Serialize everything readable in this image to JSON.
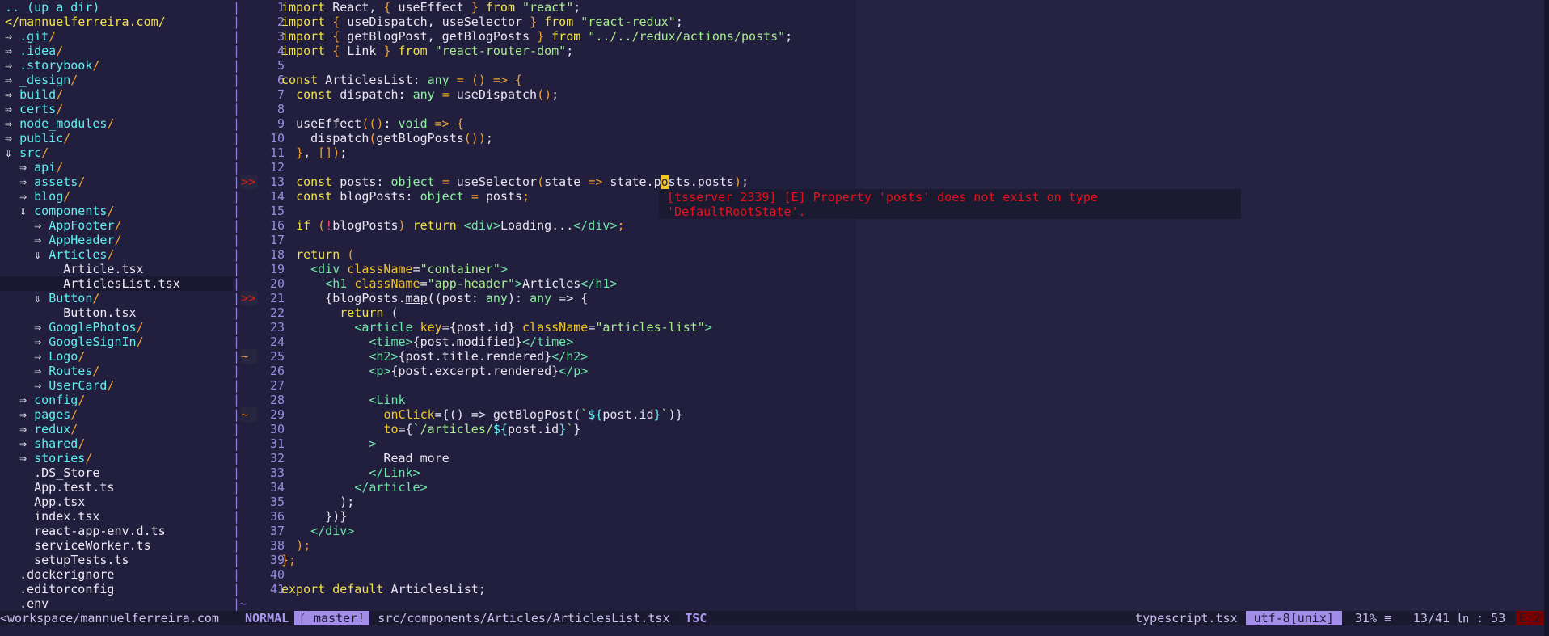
{
  "tree": [
    {
      "kind": "up",
      "text": ".. (up a dir)"
    },
    {
      "kind": "root",
      "text": "</mannuelferreira.com/"
    },
    {
      "kind": "dir",
      "indent": 0,
      "arrow": "⇒",
      "name": ".git"
    },
    {
      "kind": "dir",
      "indent": 0,
      "arrow": "⇒",
      "name": ".idea"
    },
    {
      "kind": "dir",
      "indent": 0,
      "arrow": "⇒",
      "name": ".storybook"
    },
    {
      "kind": "dir",
      "indent": 0,
      "arrow": "⇒",
      "name": "_design"
    },
    {
      "kind": "dir",
      "indent": 0,
      "arrow": "⇒",
      "name": "build"
    },
    {
      "kind": "dir",
      "indent": 0,
      "arrow": "⇒",
      "name": "certs"
    },
    {
      "kind": "dir",
      "indent": 0,
      "arrow": "⇒",
      "name": "node_modules"
    },
    {
      "kind": "dir",
      "indent": 0,
      "arrow": "⇒",
      "name": "public"
    },
    {
      "kind": "dir",
      "indent": 0,
      "arrow": "⇓",
      "name": "src"
    },
    {
      "kind": "dir",
      "indent": 1,
      "arrow": "⇒",
      "name": "api"
    },
    {
      "kind": "dir",
      "indent": 1,
      "arrow": "⇒",
      "name": "assets"
    },
    {
      "kind": "dir",
      "indent": 1,
      "arrow": "⇒",
      "name": "blog"
    },
    {
      "kind": "dir",
      "indent": 1,
      "arrow": "⇓",
      "name": "components"
    },
    {
      "kind": "dir",
      "indent": 2,
      "arrow": "⇒",
      "name": "AppFooter"
    },
    {
      "kind": "dir",
      "indent": 2,
      "arrow": "⇒",
      "name": "AppHeader"
    },
    {
      "kind": "dir",
      "indent": 2,
      "arrow": "⇓",
      "name": "Articles"
    },
    {
      "kind": "file",
      "indent": 4,
      "name": "Article.tsx"
    },
    {
      "kind": "file",
      "indent": 4,
      "name": "ArticlesList.tsx",
      "selected": true
    },
    {
      "kind": "dir",
      "indent": 2,
      "arrow": "⇓",
      "name": "Button"
    },
    {
      "kind": "file",
      "indent": 4,
      "name": "Button.tsx"
    },
    {
      "kind": "dir",
      "indent": 2,
      "arrow": "⇒",
      "name": "GooglePhotos"
    },
    {
      "kind": "dir",
      "indent": 2,
      "arrow": "⇒",
      "name": "GoogleSignIn"
    },
    {
      "kind": "dir",
      "indent": 2,
      "arrow": "⇒",
      "name": "Logo"
    },
    {
      "kind": "dir",
      "indent": 2,
      "arrow": "⇒",
      "name": "Routes"
    },
    {
      "kind": "dir",
      "indent": 2,
      "arrow": "⇒",
      "name": "UserCard"
    },
    {
      "kind": "dir",
      "indent": 1,
      "arrow": "⇒",
      "name": "config"
    },
    {
      "kind": "dir",
      "indent": 1,
      "arrow": "⇒",
      "name": "pages"
    },
    {
      "kind": "dir",
      "indent": 1,
      "arrow": "⇒",
      "name": "redux"
    },
    {
      "kind": "dir",
      "indent": 1,
      "arrow": "⇒",
      "name": "shared"
    },
    {
      "kind": "dir",
      "indent": 1,
      "arrow": "⇒",
      "name": "stories"
    },
    {
      "kind": "file",
      "indent": 2,
      "name": ".DS_Store"
    },
    {
      "kind": "file",
      "indent": 2,
      "name": "App.test.ts"
    },
    {
      "kind": "file",
      "indent": 2,
      "name": "App.tsx"
    },
    {
      "kind": "file",
      "indent": 2,
      "name": "index.tsx"
    },
    {
      "kind": "file",
      "indent": 2,
      "name": "react-app-env.d.ts"
    },
    {
      "kind": "file",
      "indent": 2,
      "name": "serviceWorker.ts"
    },
    {
      "kind": "file",
      "indent": 2,
      "name": "setupTests.ts"
    },
    {
      "kind": "file",
      "indent": 1,
      "name": ".dockerignore"
    },
    {
      "kind": "file",
      "indent": 1,
      "name": ".editorconfig"
    },
    {
      "kind": "file",
      "indent": 1,
      "name": ".env"
    }
  ],
  "code": [
    {
      "n": "1",
      "t": [
        [
          "k",
          "import"
        ],
        [
          "d",
          " React, "
        ],
        [
          "p",
          "{"
        ],
        [
          "d",
          " useEffect "
        ],
        [
          "p",
          "}"
        ],
        [
          "d",
          " "
        ],
        [
          "k",
          "from"
        ],
        [
          "d",
          " "
        ],
        [
          "s",
          "\"react\""
        ],
        [
          "d",
          ";"
        ]
      ]
    },
    {
      "n": "2",
      "t": [
        [
          "k",
          "import"
        ],
        [
          "d",
          " "
        ],
        [
          "p",
          "{"
        ],
        [
          "d",
          " useDispatch, useSelector "
        ],
        [
          "p",
          "}"
        ],
        [
          "d",
          " "
        ],
        [
          "k",
          "from"
        ],
        [
          "d",
          " "
        ],
        [
          "s",
          "\"react-redux\""
        ],
        [
          "d",
          ";"
        ]
      ]
    },
    {
      "n": "3",
      "t": [
        [
          "k",
          "import"
        ],
        [
          "d",
          " "
        ],
        [
          "p",
          "{"
        ],
        [
          "d",
          " getBlogPost, getBlogPosts "
        ],
        [
          "p",
          "}"
        ],
        [
          "d",
          " "
        ],
        [
          "k",
          "from"
        ],
        [
          "d",
          " "
        ],
        [
          "s",
          "\"../../redux/actions/posts\""
        ],
        [
          "d",
          ";"
        ]
      ]
    },
    {
      "n": "4",
      "t": [
        [
          "k",
          "import"
        ],
        [
          "d",
          " "
        ],
        [
          "p",
          "{"
        ],
        [
          "d",
          " Link "
        ],
        [
          "p",
          "}"
        ],
        [
          "d",
          " "
        ],
        [
          "k",
          "from"
        ],
        [
          "d",
          " "
        ],
        [
          "s",
          "\"react-router-dom\""
        ],
        [
          "d",
          ";"
        ]
      ]
    },
    {
      "n": "5",
      "t": []
    },
    {
      "n": "6",
      "t": [
        [
          "k",
          "const"
        ],
        [
          "d",
          " ArticlesList: "
        ],
        [
          "t",
          "any"
        ],
        [
          "d",
          " "
        ],
        [
          "p",
          "="
        ],
        [
          "d",
          " "
        ],
        [
          "p",
          "()"
        ],
        [
          "d",
          " "
        ],
        [
          "p",
          "=>"
        ],
        [
          "d",
          " "
        ],
        [
          "p",
          "{"
        ]
      ]
    },
    {
      "n": "7",
      "t": [
        [
          "d",
          "  "
        ],
        [
          "k",
          "const"
        ],
        [
          "d",
          " dispatch: "
        ],
        [
          "t",
          "any"
        ],
        [
          "d",
          " "
        ],
        [
          "p",
          "="
        ],
        [
          "d",
          " useDispatch"
        ],
        [
          "p",
          "()"
        ],
        [
          "d",
          ";"
        ]
      ]
    },
    {
      "n": "8",
      "t": []
    },
    {
      "n": "9",
      "t": [
        [
          "d",
          "  useEffect"
        ],
        [
          "p",
          "(()"
        ],
        [
          "d",
          ": "
        ],
        [
          "t",
          "void"
        ],
        [
          "d",
          " "
        ],
        [
          "p",
          "=>"
        ],
        [
          "d",
          " "
        ],
        [
          "p",
          "{"
        ]
      ]
    },
    {
      "n": "10",
      "t": [
        [
          "d",
          "    dispatch"
        ],
        [
          "p",
          "("
        ],
        [
          "d",
          "getBlogPosts"
        ],
        [
          "p",
          "())"
        ],
        [
          "d",
          ";"
        ]
      ]
    },
    {
      "n": "11",
      "t": [
        [
          "d",
          "  "
        ],
        [
          "p",
          "}"
        ],
        [
          "d",
          ", "
        ],
        [
          "p",
          "[])"
        ],
        [
          "d",
          ";"
        ]
      ]
    },
    {
      "n": "12",
      "t": []
    },
    {
      "n": "13",
      "sign": ">>",
      "t": [
        [
          "d",
          "  "
        ],
        [
          "k",
          "const"
        ],
        [
          "d",
          " posts: "
        ],
        [
          "t",
          "object"
        ],
        [
          "d",
          " "
        ],
        [
          "p",
          "="
        ],
        [
          "d",
          " useSelector"
        ],
        [
          "p",
          "("
        ],
        [
          "d",
          "state "
        ],
        [
          "p",
          "=>"
        ],
        [
          "d",
          " state."
        ],
        [
          "u",
          "p"
        ],
        [
          "cur",
          "o"
        ],
        [
          "u",
          "sts"
        ],
        [
          "d",
          ".posts"
        ],
        [
          "p",
          ")"
        ],
        [
          "d",
          ";"
        ]
      ]
    },
    {
      "n": "14",
      "t": [
        [
          "d",
          "  "
        ],
        [
          "k",
          "const"
        ],
        [
          "d",
          " blogPosts: "
        ],
        [
          "t",
          "object"
        ],
        [
          "d",
          " "
        ],
        [
          "p",
          "="
        ],
        [
          "d",
          " posts"
        ],
        [
          "p",
          ";"
        ]
      ]
    },
    {
      "n": "15",
      "t": []
    },
    {
      "n": "16",
      "t": [
        [
          "d",
          "  "
        ],
        [
          "k",
          "if"
        ],
        [
          "d",
          " "
        ],
        [
          "p",
          "("
        ],
        [
          "e",
          "!"
        ],
        [
          "d",
          "blogPosts"
        ],
        [
          "p",
          ")"
        ],
        [
          "d",
          " "
        ],
        [
          "k",
          "return"
        ],
        [
          "d",
          " "
        ],
        [
          "g",
          "<div>"
        ],
        [
          "d",
          "Loading..."
        ],
        [
          "g",
          "</div>"
        ],
        [
          "p",
          ";"
        ]
      ]
    },
    {
      "n": "17",
      "t": []
    },
    {
      "n": "18",
      "t": [
        [
          "d",
          "  "
        ],
        [
          "k",
          "return"
        ],
        [
          "d",
          " "
        ],
        [
          "p",
          "("
        ]
      ]
    },
    {
      "n": "19",
      "t": [
        [
          "d",
          "    "
        ],
        [
          "g",
          "<div"
        ],
        [
          "d",
          " "
        ],
        [
          "a",
          "className"
        ],
        [
          "d",
          "="
        ],
        [
          "s",
          "\"container\""
        ],
        [
          "g",
          ">"
        ]
      ]
    },
    {
      "n": "20",
      "t": [
        [
          "d",
          "      "
        ],
        [
          "g",
          "<h1"
        ],
        [
          "d",
          " "
        ],
        [
          "a",
          "className"
        ],
        [
          "d",
          "="
        ],
        [
          "s",
          "\"app-header\""
        ],
        [
          "g",
          ">"
        ],
        [
          "d",
          "Articles"
        ],
        [
          "g",
          "</h1>"
        ]
      ]
    },
    {
      "n": "21",
      "sign": ">>",
      "t": [
        [
          "d",
          "      {blogPosts."
        ],
        [
          "u",
          "map"
        ],
        [
          "d",
          "((post: "
        ],
        [
          "t",
          "any"
        ],
        [
          "d",
          "): "
        ],
        [
          "t",
          "any"
        ],
        [
          "d",
          " => {"
        ]
      ]
    },
    {
      "n": "22",
      "t": [
        [
          "d",
          "        "
        ],
        [
          "k",
          "return"
        ],
        [
          "d",
          " ("
        ]
      ]
    },
    {
      "n": "23",
      "t": [
        [
          "d",
          "          "
        ],
        [
          "g",
          "<article"
        ],
        [
          "d",
          " "
        ],
        [
          "a",
          "key"
        ],
        [
          "d",
          "={post.id} "
        ],
        [
          "a",
          "className"
        ],
        [
          "d",
          "="
        ],
        [
          "s",
          "\"articles-list\""
        ],
        [
          "g",
          ">"
        ]
      ]
    },
    {
      "n": "24",
      "t": [
        [
          "d",
          "            "
        ],
        [
          "g",
          "<time>"
        ],
        [
          "d",
          "{post.modified}"
        ],
        [
          "g",
          "</time>"
        ]
      ]
    },
    {
      "n": "25",
      "sign": "~",
      "t": [
        [
          "d",
          "            "
        ],
        [
          "g",
          "<h2>"
        ],
        [
          "d",
          "{post.title.rendered}"
        ],
        [
          "g",
          "</h2>"
        ]
      ]
    },
    {
      "n": "26",
      "t": [
        [
          "d",
          "            "
        ],
        [
          "g",
          "<p>"
        ],
        [
          "d",
          "{post.excerpt.rendered}"
        ],
        [
          "g",
          "</p>"
        ]
      ]
    },
    {
      "n": "27",
      "t": []
    },
    {
      "n": "28",
      "t": [
        [
          "d",
          "            "
        ],
        [
          "g",
          "<Link"
        ]
      ]
    },
    {
      "n": "29",
      "sign": "~",
      "t": [
        [
          "d",
          "              "
        ],
        [
          "a",
          "onClick"
        ],
        [
          "d",
          "={() => getBlogPost("
        ],
        [
          "s",
          "`"
        ],
        [
          "c",
          "${"
        ],
        [
          "d",
          "post.id"
        ],
        [
          "c",
          "}"
        ],
        [
          "s",
          "`"
        ],
        [
          "d",
          ")}"
        ]
      ]
    },
    {
      "n": "30",
      "t": [
        [
          "d",
          "              "
        ],
        [
          "a",
          "to"
        ],
        [
          "d",
          "={"
        ],
        [
          "s",
          "`/articles/"
        ],
        [
          "c",
          "${"
        ],
        [
          "d",
          "post.id"
        ],
        [
          "c",
          "}"
        ],
        [
          "s",
          "`"
        ],
        [
          "d",
          "}"
        ]
      ]
    },
    {
      "n": "31",
      "t": [
        [
          "d",
          "            "
        ],
        [
          "g",
          ">"
        ]
      ]
    },
    {
      "n": "32",
      "t": [
        [
          "d",
          "              Read more"
        ]
      ]
    },
    {
      "n": "33",
      "t": [
        [
          "d",
          "            "
        ],
        [
          "g",
          "</Link>"
        ]
      ]
    },
    {
      "n": "34",
      "t": [
        [
          "d",
          "          "
        ],
        [
          "g",
          "</article>"
        ]
      ]
    },
    {
      "n": "35",
      "t": [
        [
          "d",
          "        );"
        ]
      ]
    },
    {
      "n": "36",
      "t": [
        [
          "d",
          "      })}"
        ]
      ]
    },
    {
      "n": "37",
      "t": [
        [
          "d",
          "    "
        ],
        [
          "g",
          "</div>"
        ]
      ]
    },
    {
      "n": "38",
      "t": [
        [
          "d",
          "  "
        ],
        [
          "p",
          ");"
        ]
      ]
    },
    {
      "n": "39",
      "t": [
        [
          "p",
          "};"
        ]
      ]
    },
    {
      "n": "40",
      "t": []
    },
    {
      "n": "41",
      "t": [
        [
          "k",
          "export default"
        ],
        [
          "d",
          " ArticlesList;"
        ]
      ]
    }
  ],
  "end_of_buffer": "~",
  "error_popup": {
    "line1": "[tsserver 2339] [E] Property 'posts' does not exist on type",
    "line2": "'DefaultRootState'."
  },
  "status": {
    "cwd": "<workspace/mannuelferreira.com",
    "mode": "NORMAL",
    "branch": "ᚴ master!",
    "file": "src/components/Articles/ArticlesList.tsx",
    "linter": "TSC",
    "filetype": "typescript.tsx",
    "encoding": "utf-8[unix]",
    "percent": "31% ≡",
    "position": "13/41 ㏑ : 53",
    "errors": "E:2"
  }
}
